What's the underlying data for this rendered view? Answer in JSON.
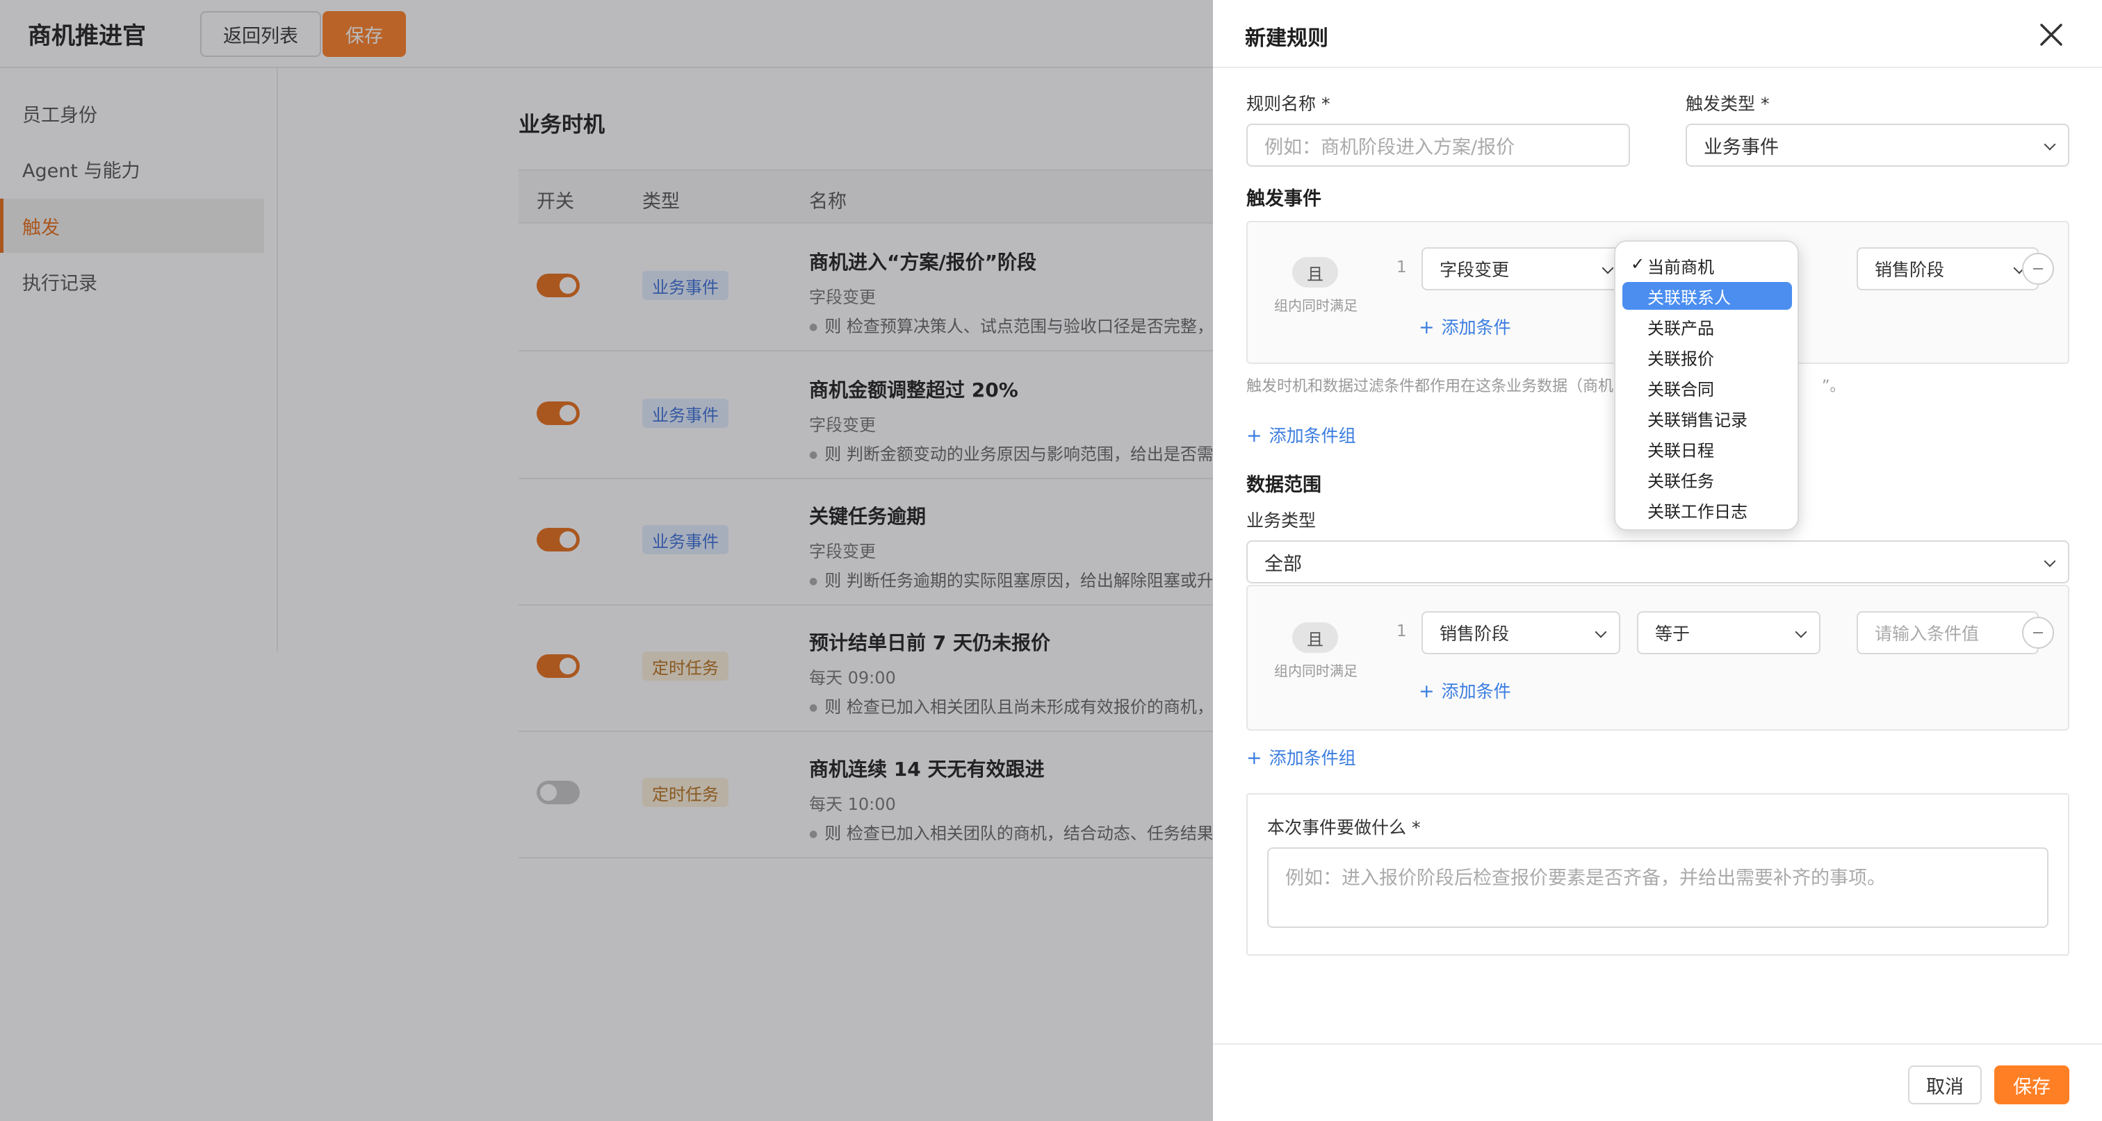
{
  "app": {
    "title": "商机推进官",
    "back_label": "返回列表",
    "save_label": "保存"
  },
  "sidebar": {
    "items": [
      {
        "label": "员工身份"
      },
      {
        "label": "Agent 与能力"
      },
      {
        "label": "触发",
        "active": true
      },
      {
        "label": "执行记录"
      }
    ]
  },
  "main": {
    "title": "业务时机",
    "columns": [
      "开关",
      "类型",
      "名称"
    ],
    "rows": [
      {
        "enabled": true,
        "type": "业务事件",
        "name": "商机进入“方案/报价”阶段",
        "sub": "字段变更",
        "desc": "则 检查预算决策人、试点范围与验收口径是否完整，补"
      },
      {
        "enabled": true,
        "type": "业务事件",
        "name": "商机金额调整超过 20%",
        "sub": "字段变更",
        "desc": "则 判断金额变动的业务原因与影响范围，给出是否需要"
      },
      {
        "enabled": true,
        "type": "业务事件",
        "name": "关键任务逾期",
        "sub": "字段变更",
        "desc": "则 判断任务逾期的实际阻塞原因，给出解除阻塞或升级"
      },
      {
        "enabled": true,
        "type": "定时任务",
        "name": "预计结单日前 7 天仍未报价",
        "sub": "每天 09:00",
        "desc": "则 检查已加入相关团队且尚未形成有效报价的商机，结"
      },
      {
        "enabled": false,
        "type": "定时任务",
        "name": "商机连续 14 天无有效跟进",
        "sub": "每天 10:00",
        "desc": "则 检查已加入相关团队的商机，结合动态、任务结果和"
      }
    ]
  },
  "drawer": {
    "title": "新建规则",
    "rule_name_label": "规则名称 *",
    "rule_name_placeholder": "例如：商机阶段进入方案/报价",
    "trigger_type_label": "触发类型 *",
    "trigger_type_value": "业务事件",
    "trigger_event_label": "触发事件",
    "group1": {
      "and_label": "且",
      "and_hint": "组内同时满足",
      "row_index": "1",
      "field1": "字段变更",
      "field3": "销售阶段",
      "add_condition": "添加条件"
    },
    "hint_text": "触发时机和数据过滤条件都作用在这条业务数据（商机",
    "hint_tail": "”。",
    "add_condition_group": "添加条件组",
    "data_scope_label": "数据范围",
    "biz_type_label": "业务类型",
    "biz_type_value": "全部",
    "group2": {
      "and_label": "且",
      "and_hint": "组内同时满足",
      "row_index": "1",
      "field1": "销售阶段",
      "operator": "等于",
      "value_placeholder": "请输入条件值",
      "add_condition": "添加条件"
    },
    "add_condition_group_2": "添加条件组",
    "task_label": "本次事件要做什么 *",
    "task_placeholder": "例如：进入报价阶段后检查报价要素是否齐备，并给出需要补齐的事项。",
    "cancel_label": "取消",
    "save_label": "保存"
  },
  "dropdown": {
    "options": [
      "当前商机",
      "关联联系人",
      "关联产品",
      "关联报价",
      "关联合同",
      "关联销售记录",
      "关联日程",
      "关联任务",
      "关联工作日志"
    ],
    "checked_index": 0,
    "highlighted_index": 1
  },
  "colors": {
    "accent": "#ff7f24",
    "link": "#3b7de0",
    "highlight": "#4b8ef0"
  }
}
